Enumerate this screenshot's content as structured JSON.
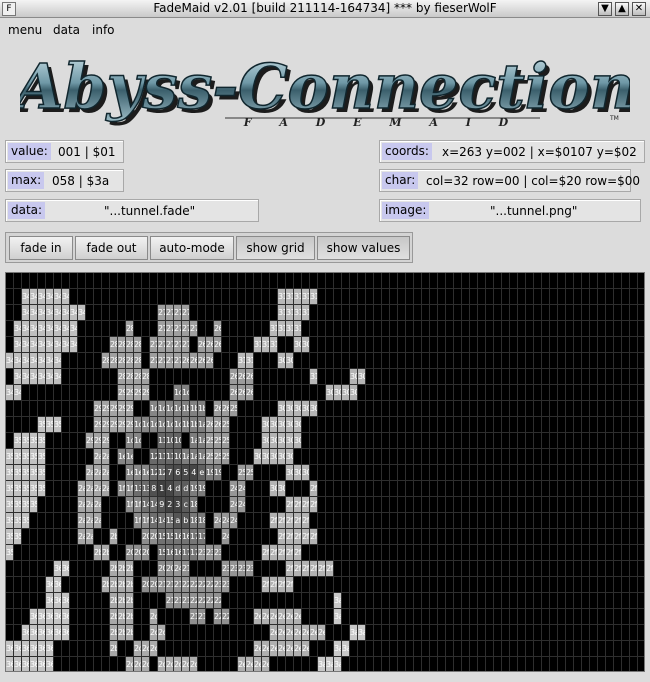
{
  "window": {
    "app_icon": "app-icon",
    "title": "FadeMaid v2.01 [build 211114-164734] *** by fieserWolF",
    "min_glyph": "▼",
    "max_glyph": "▲",
    "close_glyph": "✕"
  },
  "menu": {
    "items": [
      "menu",
      "data",
      "info"
    ]
  },
  "logo": {
    "title": "Abyss-Connection",
    "subtitle": "F A D E M A I D",
    "tm": "TM"
  },
  "fields": {
    "value": {
      "label": "value:",
      "text": "001 | $01"
    },
    "max": {
      "label": "max:",
      "text": "058 | $3a"
    },
    "data": {
      "label": "data:",
      "text": "\"...tunnel.fade\""
    },
    "coords": {
      "label": "coords:",
      "text": "x=263 y=002 | x=$0107 y=$02"
    },
    "char": {
      "label": "char:",
      "text": "col=32 row=00 | col=$20 row=$00"
    },
    "image": {
      "label": "image:",
      "text": "\"...tunnel.png\""
    }
  },
  "buttons": {
    "fade_in": "fade in",
    "fade_out": "fade out",
    "auto_mode": "auto-mode",
    "show_grid": "show grid",
    "show_values": "show values"
  },
  "canvas": {
    "columns": 80,
    "rows": 25,
    "dim_value": "01",
    "rows_data": [
      "..........................................................................",
      "....34 34 34 34 34 34 ....................................................31 31 31 31 31",
      "....34 34 34 34 34 34 34 34 ..................27 27 27 27 .....................31 31 31 31",
      "..34 34 34 34 34 34 34 34 ...........28 ......27 27 27 27 27 ....26 ...........31 31 31 31",
      "..34 34 34 34 34 34 34 34 ........28 28 28 28 ..27 27 27 27 27 ..26 26 26 .......31 31 31 ....30 30",
      "34 34 34 34 34 34 34 ..........28 28 28 28 28 ..27 27 27 27 26 26 26 26 .....31 31 ......30 30",
      "..34 34 34 34 34 34 .............28 28 28 28 ...................26 26 26 .............31 .......30 30",
      "34 34 .......................29 29 29 29 ......1c 1c .........26 26 26 ..................30 30 30 30",
      ".....................29 29 29 29 29 ...1d 1d 1c 1c 1b 1b 1b ..26 26 25 .........30 30 30 30 30",
      ".......35 35 35 ........29 29 29 29 29 1d 1d 1d 1c 1c 1c 1b 1b 1a 26 26 25 ........30 30 30 30 30",
      "..35 35 35 35 ..........29 29 29 ...1d 1d ...11 10 10 ..1a 1a 25 25 25 ........30 30 30 30 30",
      "35 35 35 35 35 ...........2a 2a ..1e 1e ....12 11 11 10 1a 1a 1a 25 25 25 ......30 30 30 30 30",
      "35 35 35 35 35 ..........2a 2a 2a ...1e 1e 1e 12 12 7 6 5 4 e 19 19 ...25 25 .......30 30 30",
      "35 35 35 35 35 ........2a 2a 2a 2a ..1f 1f 13 13 8 1 4 d d 19 19 ......24 24 ......30 30 ......2f",
      "35 35 35 35 ..........2a 2a 2a ......1f 1f 14 14 9 2 3 c 18 .......24 24 .........2f 2f 2f 2f",
      "35 35 35 ............2a 2a 2a .......1f 1f 14 14 15 a b 18 18 ..24 24 24 ........2f 2f 2f 2f 2f",
      "35 35 ..............2a 2a ....2b ......20 20 15 15 16 16 17 17 ...24 ...........2f 2f 2f 2f 2f",
      "35 ....................2b 2b ....20 20 20 ..15 16 16 17 17 23 23 23 ..........2f 2f 2f 2f 2f",
      "...........36 36 ..........2b 2b 2b ......20 20 24 21 .......23 23 23 23 .......2f 2f 2f 2f 2f 2f",
      "..........36 36 ..........2b 2b 2b 2b ..20 20 21 21 21 22 22 22 22 23 23 ........2f 2f 2f 2f",
      "..........36 36 36 ..........2b 2b 2b .......21 21 21 22 22 22 22 ...........................3a",
      "......36 36 36 36 36 ..........2b 2b 2b ...2c .......21 21 ..22 22 ......2e 2e 2e 2e 2e 2e .......3a",
      "....36 36 36 36 36 36 ..........2b 2b 2b ...2c 2c ..........................2e 2e 2e 2e 2e 2e 2e ......3a 3a",
      "36 36 36 36 36 36 .............2b ....2c 2c 2c ........................2e 2e 2e 2e 2e 2e 2e ......3a 3a",
      "36 36 36 36 36 36 ..................2c 2c 2c ..2d 2d 2d 2d 2d ..........2e 2e 2e 2e ............3a 3a 3a"
    ]
  }
}
